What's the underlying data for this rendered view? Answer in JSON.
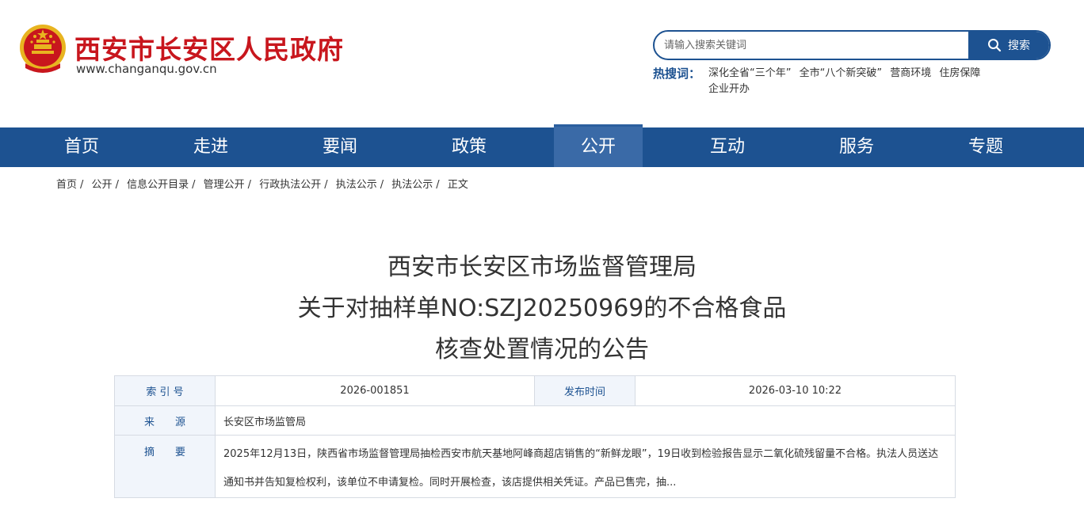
{
  "header": {
    "site_title": "西安市长安区人民政府",
    "site_domain": "www.changanqu.gov.cn",
    "search": {
      "placeholder": "请输入搜索关键词",
      "button_label": "搜索"
    },
    "hot_label": "热搜词：",
    "hot_words": [
      "深化全省“三个年”",
      "全市“八个新突破”",
      "营商环境",
      "住房保障",
      "企业开办"
    ]
  },
  "nav": {
    "items": [
      "首页",
      "走进",
      "要闻",
      "政策",
      "公开",
      "互动",
      "服务",
      "专题"
    ],
    "active": "公开"
  },
  "breadcrumb": [
    "首页",
    "公开",
    "信息公开目录",
    "管理公开",
    "行政执法公开",
    "执法公示",
    "执法公示",
    "正文"
  ],
  "article": {
    "title_lines": [
      "西安市长安区市场监督管理局",
      "关于对抽样单NO:SZJ20250969的不合格食品",
      "核查处置情况的公告"
    ]
  },
  "info": {
    "index_label": "索 引 号",
    "index_value": "2026-001851",
    "date_label": "发布时间",
    "date_value": "2026-03-10 10:22",
    "source_label": "来　　源",
    "source_value": "长安区市场监管局",
    "summary_label": "摘　　要",
    "summary_value": "2025年12月13日，陕西省市场监督管理局抽检西安市航天基地阿峰商超店销售的“新鲜龙眼”，19日收到检验报告显示二氧化硫残留量不合格。执法人员送达通知书并告知复检权利，该单位不申请复检。同时开展检查，该店提供相关凭证。产品已售完，抽..."
  },
  "colors": {
    "brand_red": "#c8161d",
    "brand_blue": "#1d5291",
    "label_bg": "#f1f5fb"
  }
}
